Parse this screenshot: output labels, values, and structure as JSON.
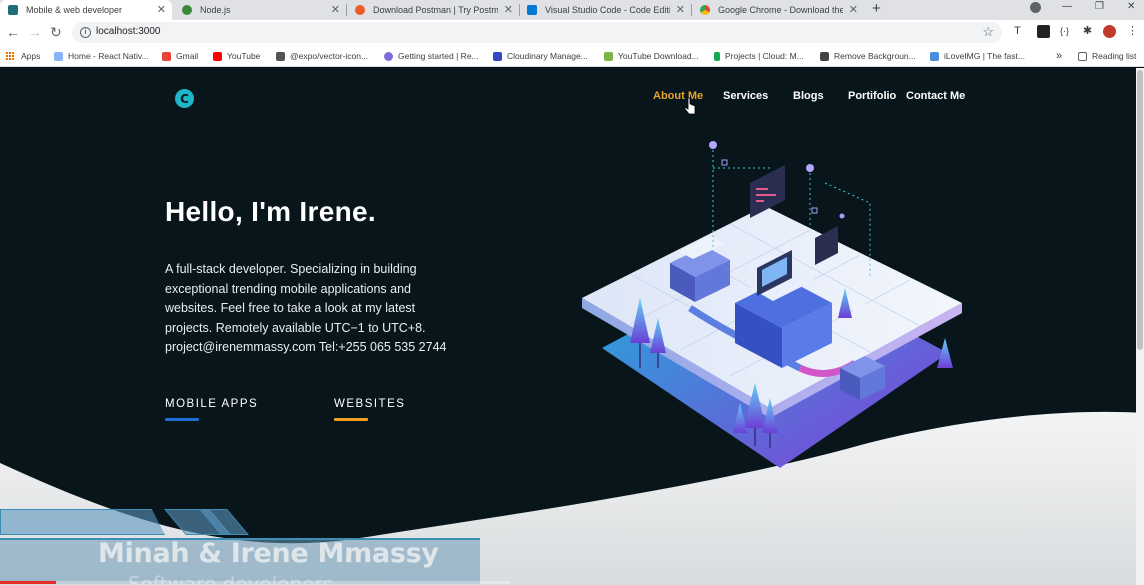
{
  "browser": {
    "tabs": [
      {
        "title": "Mobile & web developer",
        "favicon_color": "#1f6f7a"
      },
      {
        "title": "Node.js",
        "favicon_color": "#3c873a"
      },
      {
        "title": "Download Postman | Try Postman",
        "favicon_color": "#ef5b25"
      },
      {
        "title": "Visual Studio Code - Code Editing",
        "favicon_color": "#0078d4"
      },
      {
        "title": "Google Chrome - Download the",
        "favicon_color": "#4285f4"
      }
    ],
    "url": "localhost:3000",
    "bookmarks": [
      {
        "label": "Apps"
      },
      {
        "label": "Home - React Nativ...",
        "color": "#8ab4f8"
      },
      {
        "label": "Gmail",
        "color": "#ea4335"
      },
      {
        "label": "YouTube",
        "color": "#ff0000"
      },
      {
        "label": "@expo/vector-icon...",
        "color": "#555555"
      },
      {
        "label": "Getting started | Re...",
        "color": "#7c6cd8"
      },
      {
        "label": "Cloudinary Manage...",
        "color": "#3448c5"
      },
      {
        "label": "YouTube Download...",
        "color": "#7cb342"
      },
      {
        "label": "Projects | Cloud: M...",
        "color": "#13aa52"
      },
      {
        "label": "Remove Backgroun...",
        "color": "#444444"
      },
      {
        "label": "iLoveIMG | The fast...",
        "color": "#4a90e2"
      }
    ],
    "bookmarks_overflow": "»",
    "reading_list": "Reading list"
  },
  "site": {
    "logo_letter": "C",
    "nav": [
      "About Me",
      "Services",
      "Blogs",
      "Portifolio",
      "Contact Me"
    ],
    "active_nav": "About Me",
    "hero_title": "Hello, I'm Irene.",
    "hero_description": "A full-stack developer. Specializing in building exceptional trending mobile applications and websites. Feel free to take a look at my latest projects. Remotely available UTC−1 to UTC+8. project@irenemmassy.com Tel:+255 065 535 2744",
    "categories": [
      {
        "label": "MOBILE APPS",
        "underline_color": "#1e6fd1"
      },
      {
        "label": "WEBSITES",
        "underline_color": "#f0a020"
      }
    ]
  },
  "video_overlay": {
    "name": "Minah & Irene Mmassy",
    "role": "Software developers",
    "progress": 0.11
  },
  "colors": {
    "background": "#08161b",
    "accent": "#e6a42a",
    "logo": "#1fb6c8"
  }
}
